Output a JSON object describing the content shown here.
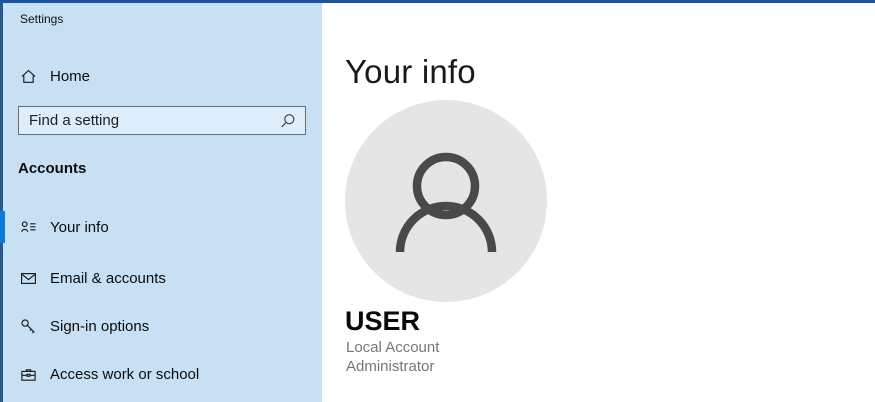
{
  "window": {
    "title": "Settings"
  },
  "sidebar": {
    "home": {
      "label": "Home",
      "icon": "home-icon"
    },
    "search": {
      "placeholder": "Find a setting",
      "icon": "search-icon"
    },
    "section_header": "Accounts",
    "items": [
      {
        "label": "Your info",
        "icon": "contact-info-icon",
        "selected": true
      },
      {
        "label": "Email & accounts",
        "icon": "email-icon",
        "selected": false
      },
      {
        "label": "Sign-in options",
        "icon": "key-icon",
        "selected": false
      },
      {
        "label": "Access work or school",
        "icon": "briefcase-icon",
        "selected": false
      }
    ]
  },
  "content": {
    "title": "Your info",
    "avatar_icon": "person-silhouette-icon",
    "username": "USER",
    "account_type": "Local Account",
    "role": "Administrator"
  },
  "colors": {
    "accent_pipe": "#0c7bd9",
    "sidebar_background": "#c7e0f3",
    "window_border": "#1b55a2",
    "avatar_background": "#e5e5e5",
    "muted_text": "#767676"
  }
}
